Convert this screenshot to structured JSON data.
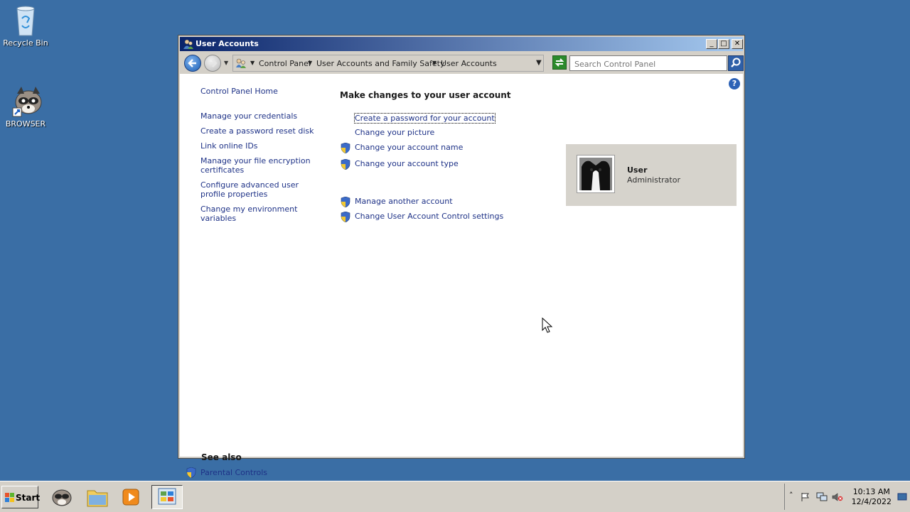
{
  "desktop": {
    "icons": [
      {
        "label": "Recycle Bin",
        "icon": "recycle-bin-icon"
      },
      {
        "label": "BROWSER",
        "icon": "raccoon-browser-icon"
      }
    ]
  },
  "window": {
    "title": "User Accounts",
    "breadcrumbs": [
      "Control Panel",
      "User Accounts and Family Safety",
      "User Accounts"
    ],
    "search_placeholder": "Search Control Panel"
  },
  "left_nav": {
    "home": "Control Panel Home",
    "items": [
      "Manage your credentials",
      "Create a password reset disk",
      "Link online IDs",
      "Manage your file encryption certificates",
      "Configure advanced user profile properties",
      "Change my environment variables"
    ],
    "see_also_heading": "See also",
    "see_also": [
      "Parental Controls"
    ]
  },
  "main": {
    "heading": "Make changes to your user account",
    "tasks": [
      {
        "label": "Create a password for your account",
        "shield": false
      },
      {
        "label": "Change your picture",
        "shield": false
      },
      {
        "label": "Change your account name",
        "shield": true
      },
      {
        "label": "Change your account type",
        "shield": true
      },
      {
        "label": "Manage another account",
        "shield": true
      },
      {
        "label": "Change User Account Control settings",
        "shield": true
      }
    ]
  },
  "user": {
    "name": "User",
    "role": "Administrator"
  },
  "taskbar": {
    "start_label": "Start",
    "time": "10:13 AM",
    "date": "12/4/2022"
  },
  "colors": {
    "desktop": "#3a6ea5",
    "link": "#1e3287",
    "title_gradient_start": "#0a246a"
  }
}
